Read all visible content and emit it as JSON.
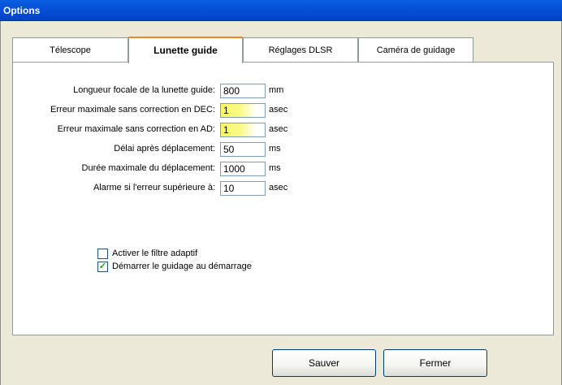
{
  "window": {
    "title": "Options"
  },
  "tabs": [
    {
      "label": "Télescope"
    },
    {
      "label": "Lunette guide"
    },
    {
      "label": "Réglages DLSR"
    },
    {
      "label": "Caméra de guidage"
    }
  ],
  "active_tab": "Lunette guide",
  "fields": [
    {
      "label": "Longueur focale de la lunette guide:",
      "value": "800",
      "unit": "mm"
    },
    {
      "label": "Erreur maximale sans correction en DEC:",
      "value": "1",
      "unit": "asec"
    },
    {
      "label": "Erreur maximale sans correction en AD:",
      "value": "1",
      "unit": "asec"
    },
    {
      "label": "Délai après déplacement:",
      "value": "50",
      "unit": "ms"
    },
    {
      "label": "Durée maximale du déplacement:",
      "value": "1000",
      "unit": "ms"
    },
    {
      "label": "Alarme si l'erreur supérieure à:",
      "value": "10",
      "unit": "asec"
    }
  ],
  "checkboxes": [
    {
      "label": "Activer le filtre adaptif",
      "checked": false
    },
    {
      "label": "Démarrer le guidage au démarrage",
      "checked": true
    }
  ],
  "buttons": {
    "save": "Sauver",
    "close": "Fermer"
  },
  "colors": {
    "title_bar": "#0450d8",
    "active_tab_accent": "#e68b2c",
    "highlight": "#f9f76a"
  }
}
